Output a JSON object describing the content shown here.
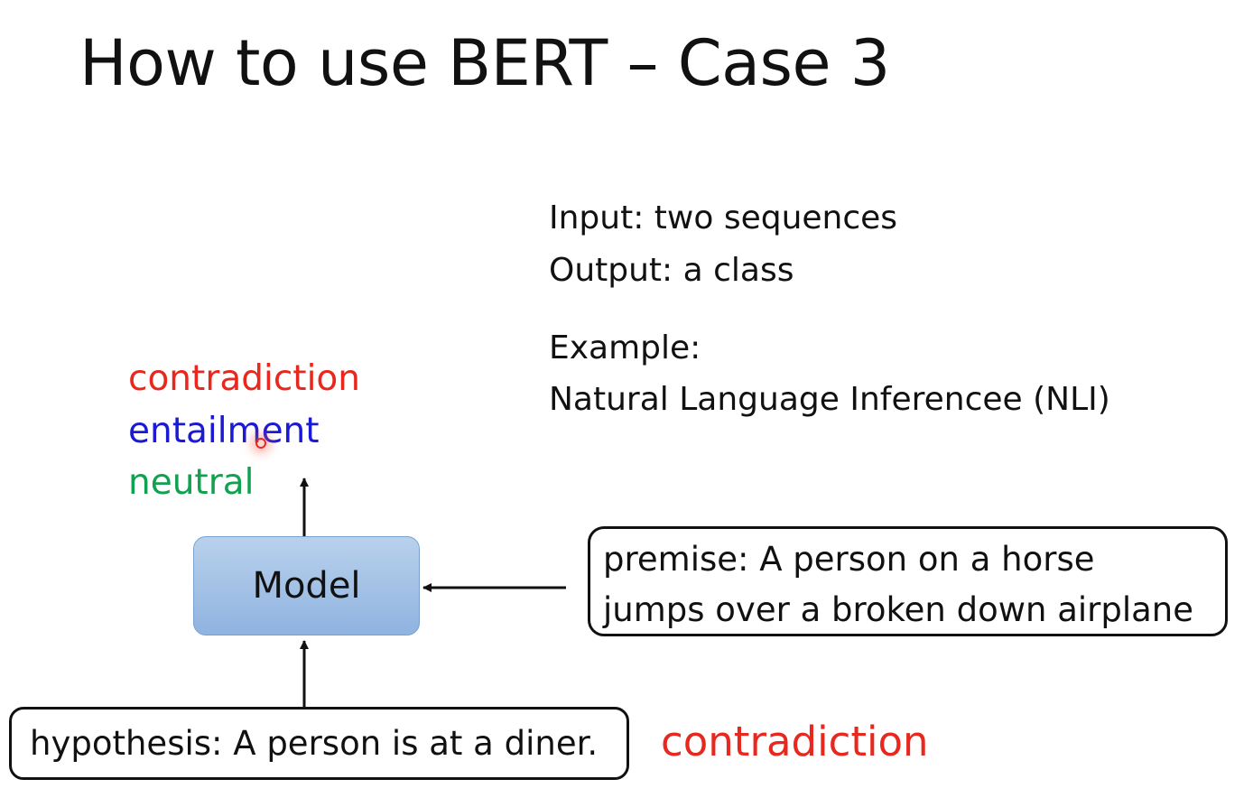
{
  "slide": {
    "title": "How to use BERT – Case 3"
  },
  "info": {
    "input_line": "Input: two sequences",
    "output_line": "Output: a class",
    "example_heading": "Example:",
    "example_name": "Natural Language Inferencee (NLI)"
  },
  "classes": [
    {
      "label": "contradiction",
      "color": "#e8281e"
    },
    {
      "label": "entailment",
      "color": "#1a1ad6"
    },
    {
      "label": "neutral",
      "color": "#12a150"
    }
  ],
  "model": {
    "label": "Model"
  },
  "premise": {
    "line1": "premise: A person on a horse",
    "line2": "jumps over a broken down airplane"
  },
  "hypothesis": {
    "text": "hypothesis: A person is at a diner."
  },
  "answer": {
    "label": "contradiction",
    "color": "#e8281e"
  }
}
